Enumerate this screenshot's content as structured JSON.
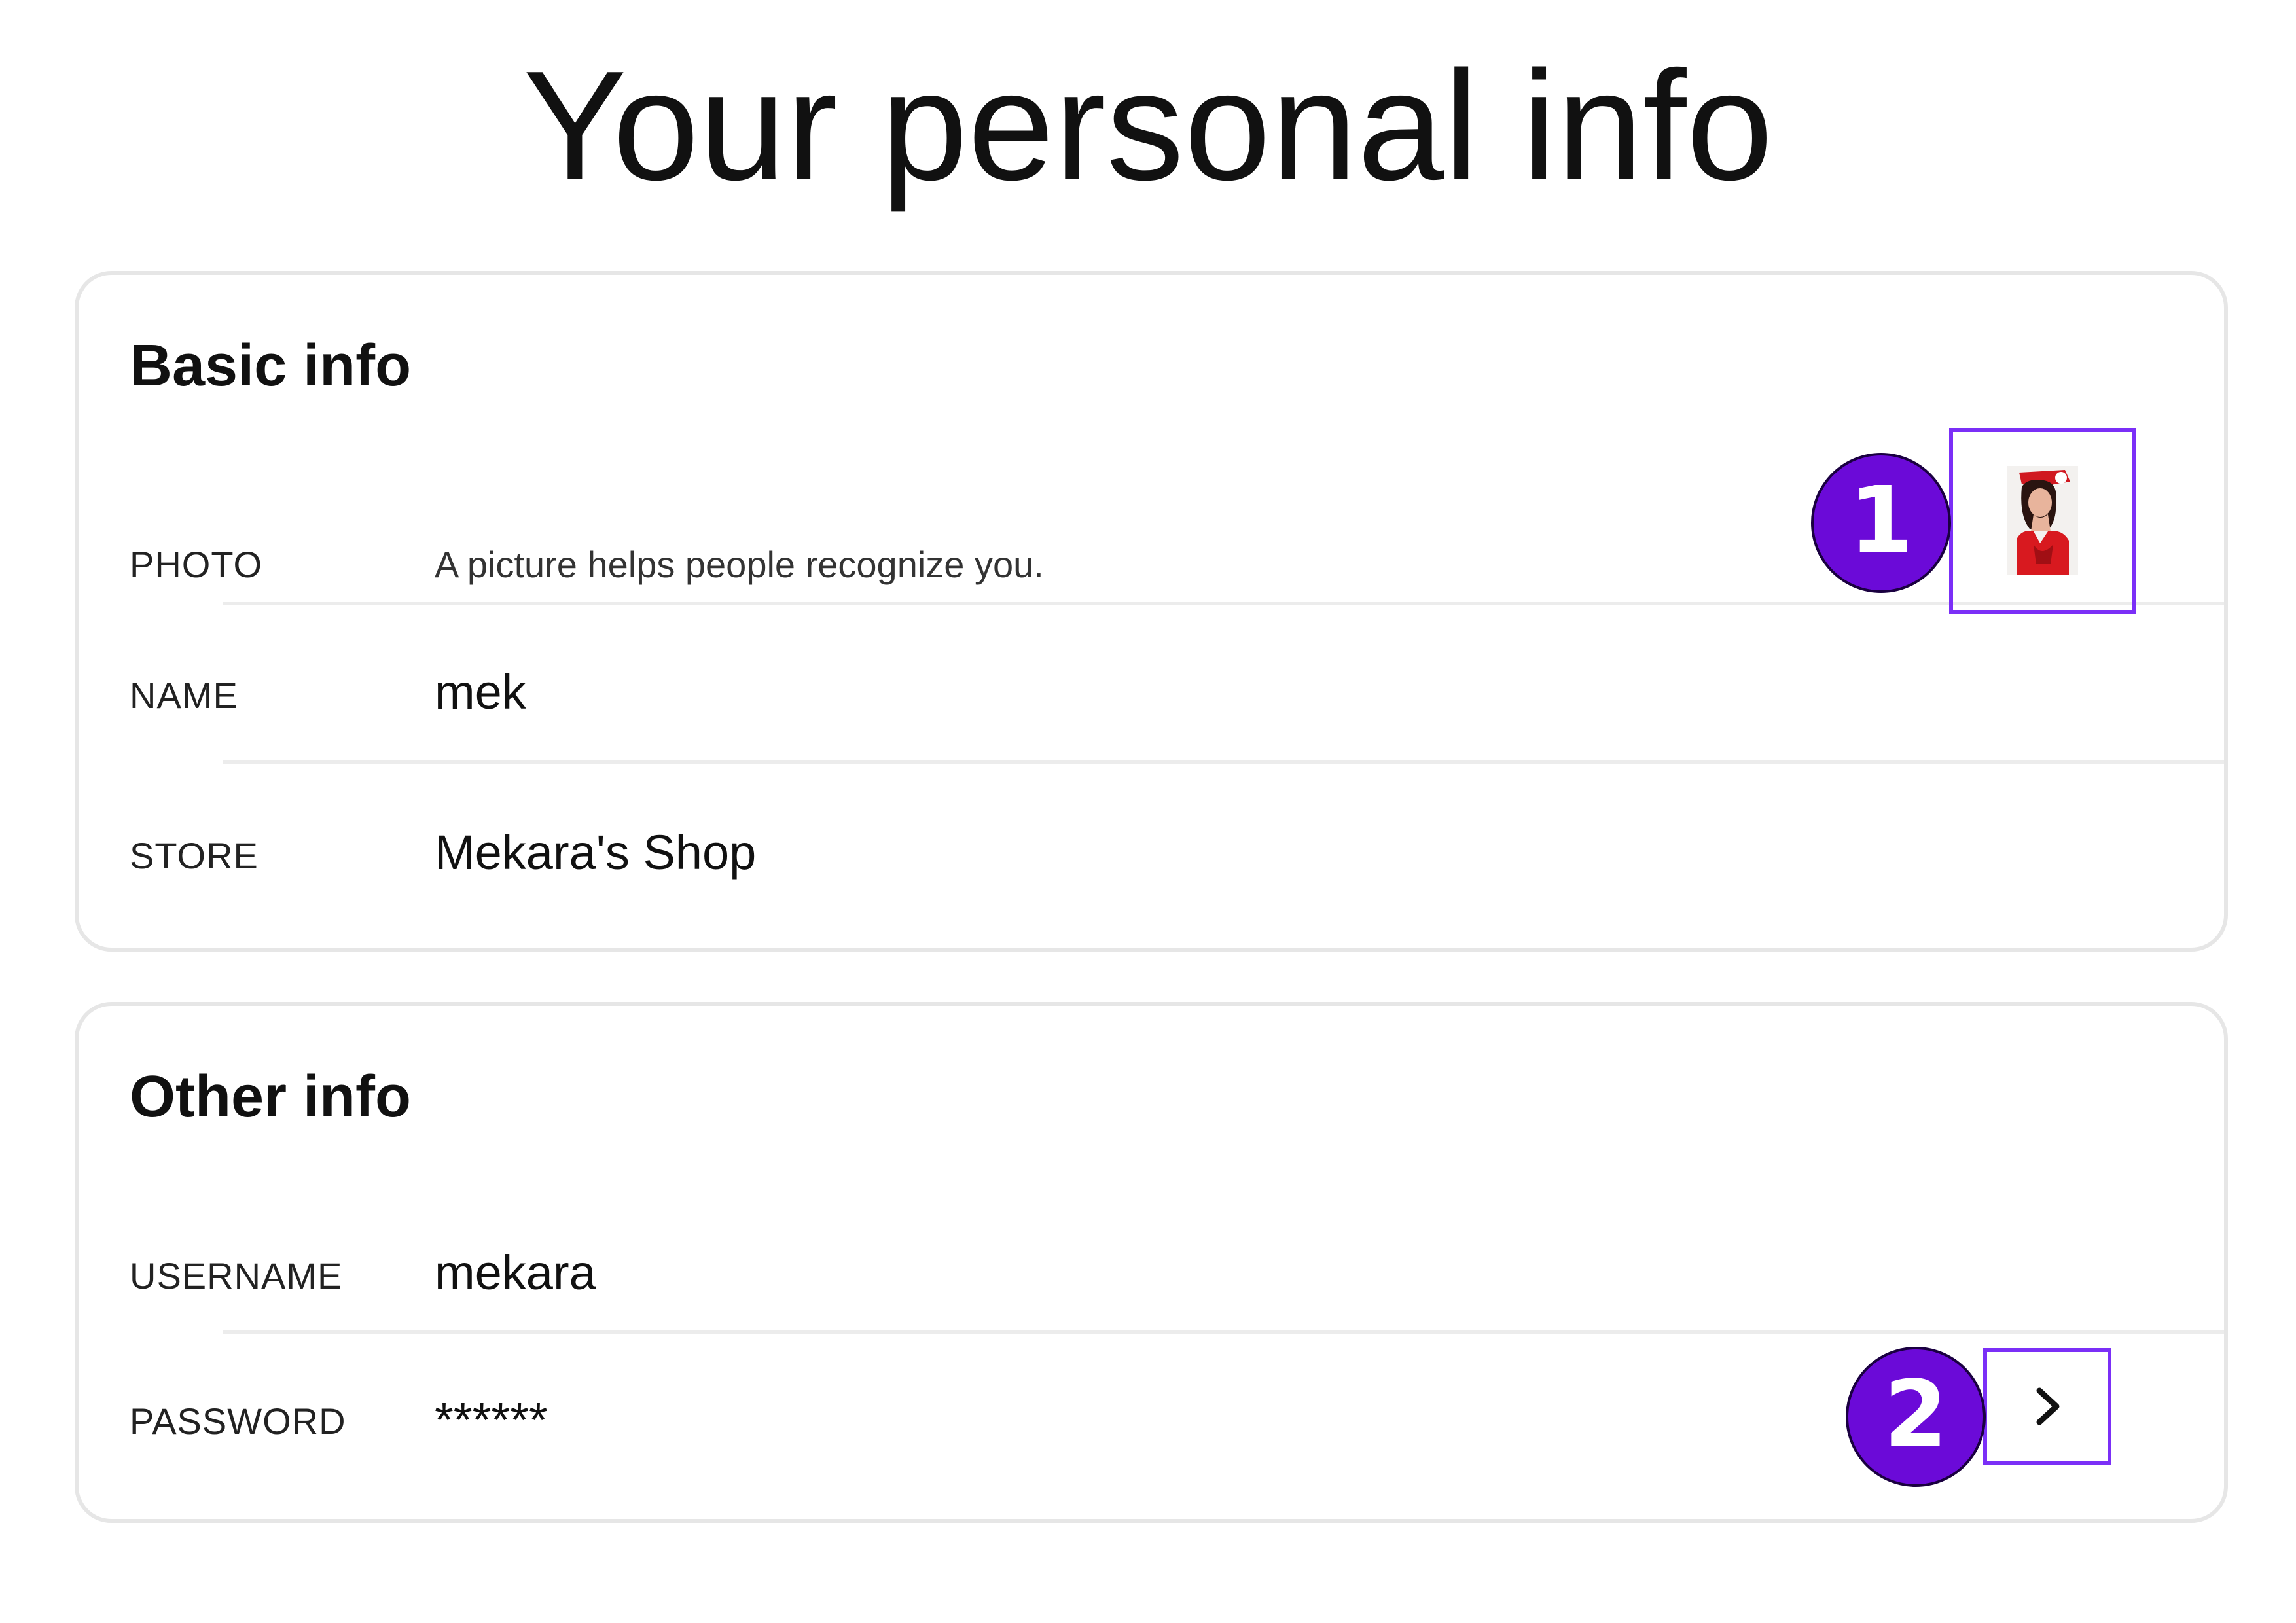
{
  "page": {
    "title": "Your personal info"
  },
  "basic_info": {
    "title": "Basic info",
    "photo": {
      "label": "PHOTO",
      "description": "A picture helps people recognize you.",
      "marker_number": "1"
    },
    "name": {
      "label": "NAME",
      "value": "mek"
    },
    "store": {
      "label": "STORE",
      "value": "Mekara's Shop"
    }
  },
  "other_info": {
    "title": "Other info",
    "username": {
      "label": "USERNAME",
      "value": "mekara"
    },
    "password": {
      "label": "PASSWORD",
      "value": "******",
      "marker_number": "2"
    }
  },
  "colors": {
    "marker_border": "#7b2ff7",
    "badge_fill": "#6b0ad8",
    "card_border": "#e6e6e6"
  },
  "icons": {
    "password_action": "chevron-right-icon"
  }
}
